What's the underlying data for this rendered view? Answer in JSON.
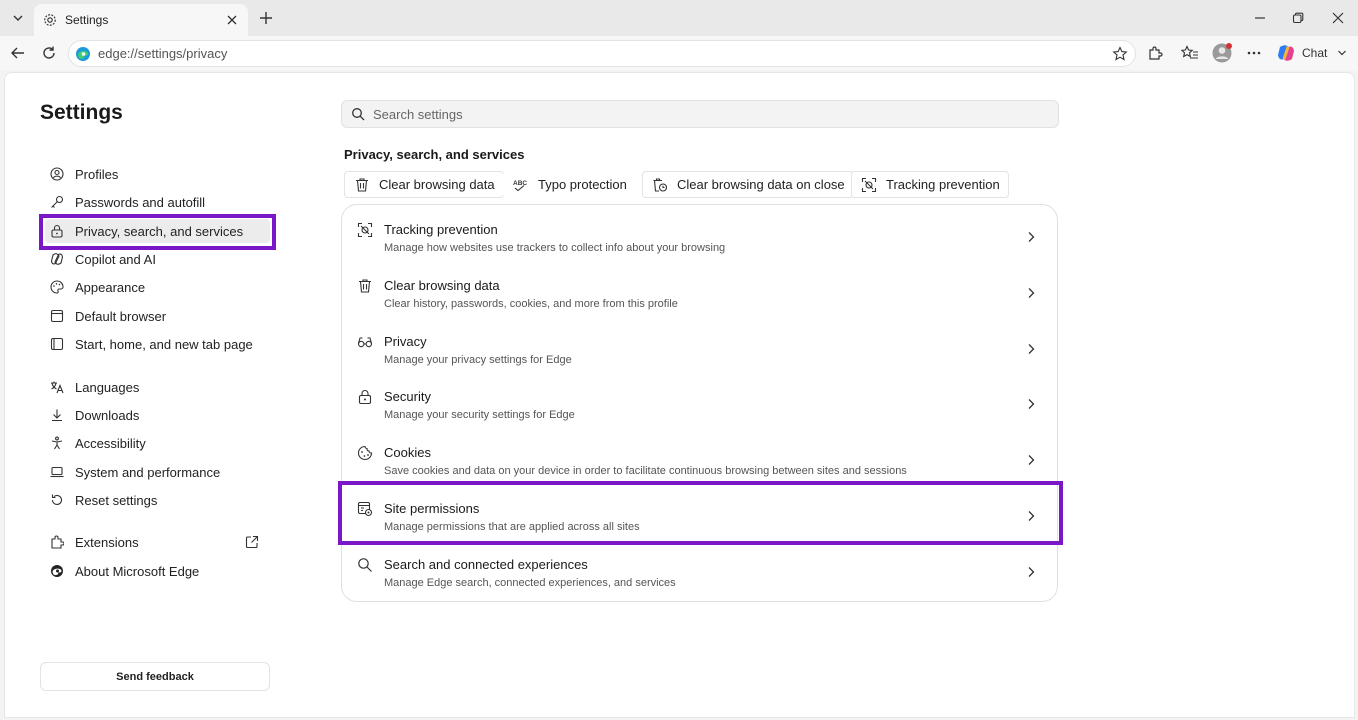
{
  "browser": {
    "tab_title": "Settings",
    "url": "edge://settings/privacy",
    "chat_label": "Chat"
  },
  "sidebar": {
    "title": "Settings",
    "items": [
      {
        "label": "Profiles",
        "icon": "profile-icon"
      },
      {
        "label": "Passwords and autofill",
        "icon": "key-icon"
      },
      {
        "label": "Privacy, search, and services",
        "icon": "lock-icon",
        "active": true
      },
      {
        "label": "Copilot and AI",
        "icon": "copilot-icon"
      },
      {
        "label": "Appearance",
        "icon": "palette-icon"
      },
      {
        "label": "Default browser",
        "icon": "browser-icon"
      },
      {
        "label": "Start, home, and new tab page",
        "icon": "home-icon"
      },
      {
        "label": "Languages",
        "icon": "languages-icon"
      },
      {
        "label": "Downloads",
        "icon": "download-icon"
      },
      {
        "label": "Accessibility",
        "icon": "accessibility-icon"
      },
      {
        "label": "System and performance",
        "icon": "laptop-icon"
      },
      {
        "label": "Reset settings",
        "icon": "reset-icon"
      },
      {
        "label": "Extensions",
        "icon": "extensions-icon"
      },
      {
        "label": "About Microsoft Edge",
        "icon": "edge-logo-icon"
      }
    ],
    "feedback_label": "Send feedback"
  },
  "main": {
    "search_placeholder": "Search settings",
    "section_title": "Privacy, search, and services",
    "chips": [
      {
        "label": "Clear browsing data",
        "icon": "trash-icon"
      },
      {
        "label": "Typo protection",
        "icon": "abc-icon"
      },
      {
        "label": "Clear browsing data on close",
        "icon": "trash-clock-icon"
      },
      {
        "label": "Tracking prevention",
        "icon": "tracking-icon"
      }
    ],
    "rows": [
      {
        "title": "Tracking prevention",
        "subtitle": "Manage how websites use trackers to collect info about your browsing",
        "icon": "tracking-icon"
      },
      {
        "title": "Clear browsing data",
        "subtitle": "Clear history, passwords, cookies, and more from this profile",
        "icon": "trash-icon"
      },
      {
        "title": "Privacy",
        "subtitle": "Manage your privacy settings for Edge",
        "icon": "glasses-icon"
      },
      {
        "title": "Security",
        "subtitle": "Manage your security settings for Edge",
        "icon": "lock-icon"
      },
      {
        "title": "Cookies",
        "subtitle": "Save cookies and data on your device in order to facilitate continuous browsing between sites and sessions",
        "icon": "cookie-icon"
      },
      {
        "title": "Site permissions",
        "subtitle": "Manage permissions that are applied across all sites",
        "icon": "site-permissions-icon",
        "highlighted": true
      },
      {
        "title": "Search and connected experiences",
        "subtitle": "Manage Edge search, connected experiences, and services",
        "icon": "search-icon"
      }
    ]
  },
  "colors": {
    "highlight": "#7a18c8"
  }
}
